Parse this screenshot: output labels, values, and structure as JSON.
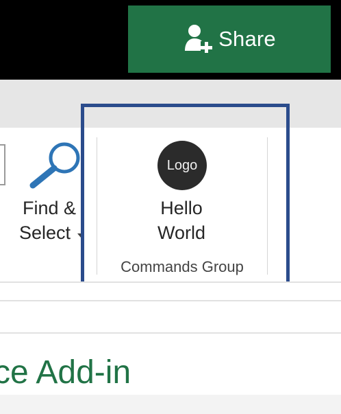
{
  "share": {
    "label": "Share",
    "icon": "add-person-icon",
    "color": "#217346"
  },
  "ribbon": {
    "find_select": {
      "line1": "Find &",
      "line2": "Select",
      "icon": "magnifier-icon"
    },
    "hello_world": {
      "logo_text": "Logo",
      "line1": "Hello",
      "line2": "World"
    },
    "group_label": "Commands Group",
    "highlight_color": "#2b4c8c"
  },
  "pane": {
    "title": "ce Add-in",
    "title_color": "#217346"
  }
}
